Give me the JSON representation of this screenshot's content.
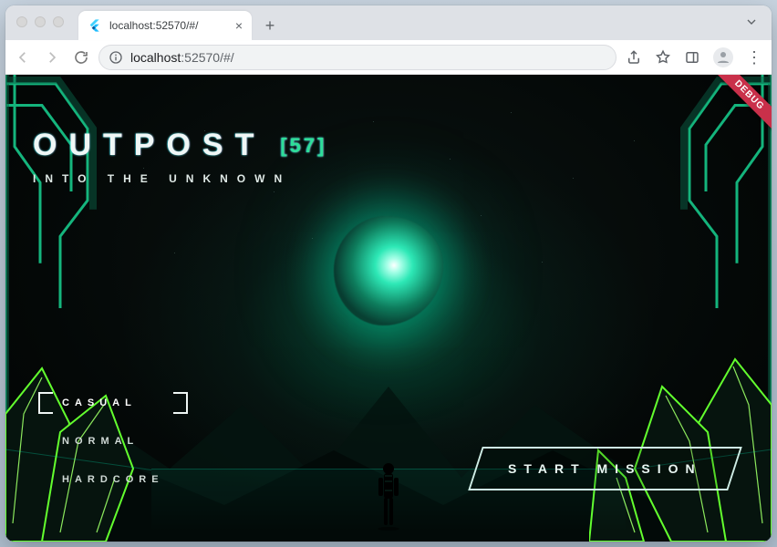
{
  "browser": {
    "tab_title": "localhost:52570/#/",
    "url_host": "localhost",
    "url_port_path": ":52570/#/"
  },
  "banner": {
    "label": "DEBUG"
  },
  "title": {
    "main": "OUTPOST",
    "badge": "[57]",
    "subtitle": "INTO THE UNKNOWN"
  },
  "difficulty": {
    "options": [
      "CASUAL",
      "NORMAL",
      "HARDCORE"
    ],
    "selected_index": 0
  },
  "cta": {
    "label": "START MISSION"
  },
  "colors": {
    "accent": "#2ddf98",
    "glow": "#2de8b6",
    "ui_line": "#cfeee6"
  }
}
